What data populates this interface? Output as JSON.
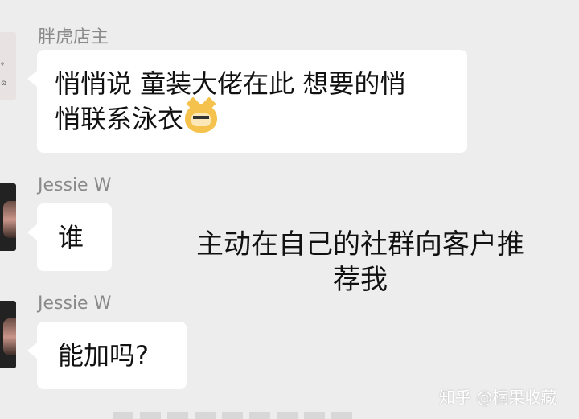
{
  "messages": [
    {
      "sender": "胖虎店主",
      "text": "悄悄说 童装大佬在此 想要的悄\n悄联系泳衣",
      "emoji": "doge-emoji"
    },
    {
      "sender": "Jessie W",
      "text": "谁"
    },
    {
      "sender": "Jessie W",
      "text": "能加吗?"
    }
  ],
  "overlay_text": "主动在自己的社群向客户推\n荐我",
  "watermark": "知乎 @楠果收藏",
  "colors": {
    "background": "#ededed",
    "bubble": "#ffffff",
    "sender_name": "#8a8a8a"
  }
}
